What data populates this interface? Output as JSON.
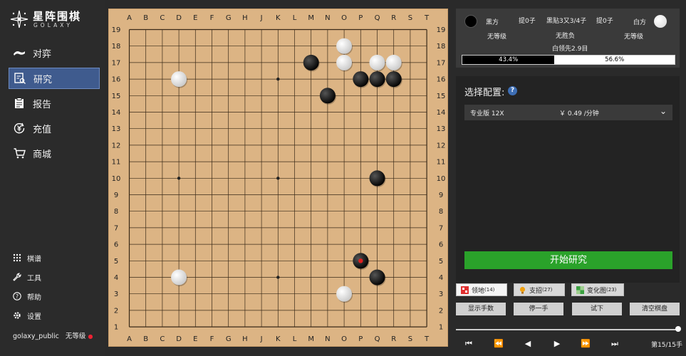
{
  "app": {
    "logo_cn": "星阵围棋",
    "logo_en": "GOLAXY"
  },
  "sidebar": {
    "items": [
      {
        "label": "对弈",
        "icon": "play-hand-icon",
        "active": false
      },
      {
        "label": "研究",
        "icon": "research-icon",
        "active": true
      },
      {
        "label": "报告",
        "icon": "report-icon",
        "active": false
      },
      {
        "label": "充值",
        "icon": "recharge-icon",
        "active": false
      },
      {
        "label": "商城",
        "icon": "cart-icon",
        "active": false
      }
    ],
    "sub_items": [
      {
        "label": "棋谱",
        "icon": "grid-icon"
      },
      {
        "label": "工具",
        "icon": "wrench-icon"
      },
      {
        "label": "帮助",
        "icon": "help-icon"
      },
      {
        "label": "设置",
        "icon": "gear-icon"
      }
    ],
    "user": {
      "name": "golaxy_public",
      "rank": "无等级"
    }
  },
  "board": {
    "columns": [
      "A",
      "B",
      "C",
      "D",
      "E",
      "F",
      "G",
      "H",
      "J",
      "K",
      "L",
      "M",
      "N",
      "O",
      "P",
      "Q",
      "R",
      "S",
      "T"
    ],
    "rows": [
      "19",
      "18",
      "17",
      "16",
      "15",
      "14",
      "13",
      "12",
      "11",
      "10",
      "9",
      "8",
      "7",
      "6",
      "5",
      "4",
      "3",
      "2",
      "1"
    ],
    "stones": [
      {
        "color": "black",
        "col": "M",
        "row": 17
      },
      {
        "color": "black",
        "col": "N",
        "row": 15
      },
      {
        "color": "black",
        "col": "P",
        "row": 16
      },
      {
        "color": "black",
        "col": "Q",
        "row": 16
      },
      {
        "color": "black",
        "col": "R",
        "row": 16
      },
      {
        "color": "black",
        "col": "Q",
        "row": 10
      },
      {
        "color": "black",
        "col": "P",
        "row": 5,
        "last_move": true
      },
      {
        "color": "black",
        "col": "Q",
        "row": 4
      },
      {
        "color": "white",
        "col": "O",
        "row": 18
      },
      {
        "color": "white",
        "col": "O",
        "row": 17
      },
      {
        "color": "white",
        "col": "Q",
        "row": 17
      },
      {
        "color": "white",
        "col": "R",
        "row": 17
      },
      {
        "color": "white",
        "col": "D",
        "row": 16
      },
      {
        "color": "white",
        "col": "D",
        "row": 4
      },
      {
        "color": "white",
        "col": "O",
        "row": 3
      }
    ],
    "colors": {
      "board": "#dcb484",
      "last_move_marker": "#e02020"
    }
  },
  "players": {
    "black_label": "黑方",
    "black_rank": "无等级",
    "black_captures": "提0子",
    "white_label": "白方",
    "white_rank": "无等级",
    "white_captures": "提0子",
    "komi": "黑贴3又3/4子",
    "result": "无胜负",
    "lead": "白领先2.9目",
    "black_winrate": "43.4%",
    "white_winrate": "56.6%",
    "black_winrate_value": 43.4
  },
  "config": {
    "title": "选择配置:",
    "help": "?",
    "selected_model": "专业版 12X",
    "price": "￥ 0.49 /分钟",
    "start_label": "开始研究"
  },
  "tools": [
    {
      "label": "领地",
      "count": "(14)",
      "icon": "territory-icon"
    },
    {
      "label": "支招",
      "count": "(27)",
      "icon": "bulb-icon"
    },
    {
      "label": "变化图",
      "count": "(23)",
      "icon": "variation-icon"
    }
  ],
  "actions": [
    "显示手数",
    "停一手",
    "试下",
    "清空棋盘"
  ],
  "playback": {
    "icons": [
      "first-icon",
      "fast-back-icon",
      "back-icon",
      "forward-icon",
      "fast-forward-icon",
      "last-icon"
    ],
    "move_count": "第15/15手"
  }
}
